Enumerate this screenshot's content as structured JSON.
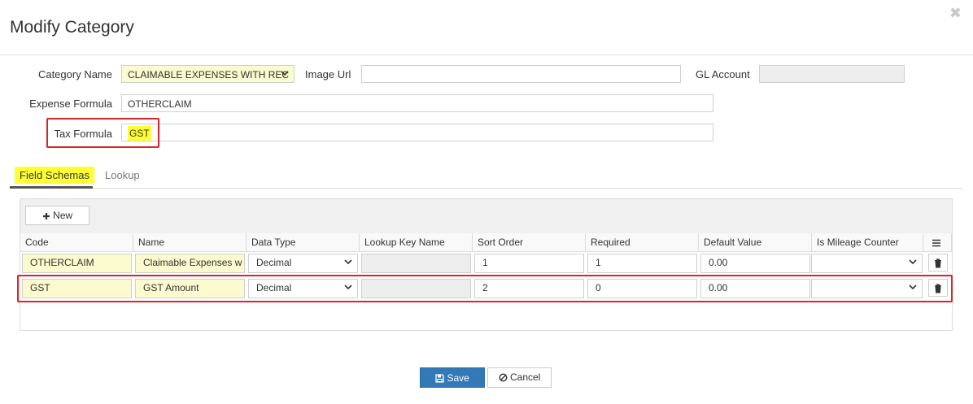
{
  "dialog": {
    "title": "Modify Category",
    "close_glyph": "✖"
  },
  "form": {
    "category_name_label": "Category Name",
    "category_name_value": "CLAIMABLE EXPENSES WITH REC",
    "image_url_label": "Image Url",
    "image_url_value": "",
    "gl_account_label": "GL Account",
    "gl_account_value": "",
    "expense_formula_label": "Expense Formula",
    "expense_formula_value": "OTHERCLAIM",
    "tax_formula_label": "Tax Formula",
    "tax_formula_value": "GST"
  },
  "tabs": [
    {
      "label": "Field Schemas",
      "active": true
    },
    {
      "label": "Lookup",
      "active": false
    }
  ],
  "grid": {
    "new_button_label": "New",
    "columns": [
      "Code",
      "Name",
      "Data Type",
      "Lookup Key Name",
      "Sort Order",
      "Required",
      "Default Value",
      "Is Mileage Counter"
    ],
    "rows": [
      {
        "code": "OTHERCLAIM",
        "name": "Claimable Expenses w",
        "data_type": "Decimal",
        "lookup_key": "",
        "sort_order": "1",
        "required": "1",
        "default_value": "0.00",
        "mileage": ""
      },
      {
        "code": "GST",
        "name": "GST Amount",
        "data_type": "Decimal",
        "lookup_key": "",
        "sort_order": "2",
        "required": "0",
        "default_value": "0.00",
        "mileage": ""
      }
    ]
  },
  "footer": {
    "save_label": "Save",
    "cancel_label": "Cancel"
  },
  "colors": {
    "primary": "#3379b7",
    "highlight": "#ffff33",
    "annotation_red": "#d9242b",
    "readonly_yellow": "#fbfbcf"
  }
}
